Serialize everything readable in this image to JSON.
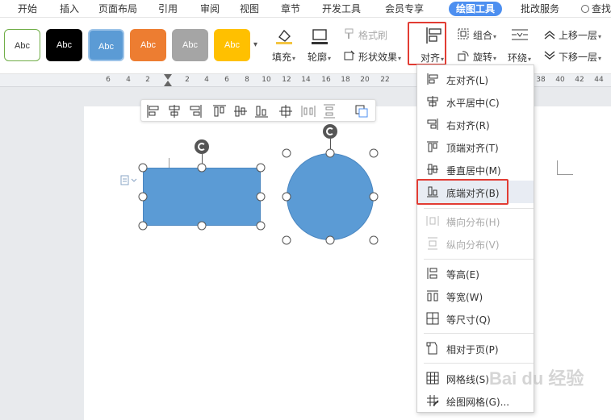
{
  "menu": {
    "tabs": [
      "开始",
      "插入",
      "页面布局",
      "引用",
      "审阅",
      "视图",
      "章节",
      "开发工具",
      "会员专享",
      "绘图工具",
      "批改服务"
    ],
    "active_tab": "绘图工具",
    "search": "查找"
  },
  "ribbon": {
    "styles": [
      "Abc",
      "Abc",
      "Abc",
      "Abc",
      "Abc",
      "Abc"
    ],
    "fill": "填充",
    "outline": "轮廓",
    "format_brush": "格式刷",
    "shape_effects": "形状效果",
    "align": "对齐",
    "group": "组合",
    "rotate": "旋转",
    "wrap": "环绕",
    "move_up": "上移一层",
    "move_down": "下移一层"
  },
  "ruler": [
    "6",
    "4",
    "2",
    "2",
    "4",
    "6",
    "8",
    "10",
    "12",
    "14",
    "16",
    "18",
    "20",
    "22",
    "38",
    "40",
    "42",
    "44"
  ],
  "align_menu": {
    "items": [
      {
        "label": "左对齐(L)",
        "icon": "align-left-icon"
      },
      {
        "label": "水平居中(C)",
        "icon": "align-center-icon"
      },
      {
        "label": "右对齐(R)",
        "icon": "align-right-icon"
      },
      {
        "label": "顶端对齐(T)",
        "icon": "align-top-icon"
      },
      {
        "label": "垂直居中(M)",
        "icon": "align-middle-icon"
      },
      {
        "label": "底端对齐(B)",
        "icon": "align-bottom-icon"
      },
      {
        "label": "横向分布(H)",
        "icon": "distribute-horizontal-icon"
      },
      {
        "label": "纵向分布(V)",
        "icon": "distribute-vertical-icon"
      },
      {
        "label": "等高(E)",
        "icon": "equal-height-icon"
      },
      {
        "label": "等宽(W)",
        "icon": "equal-width-icon"
      },
      {
        "label": "等尺寸(Q)",
        "icon": "equal-size-icon"
      },
      {
        "label": "相对于页(P)",
        "icon": "relative-to-page-icon"
      },
      {
        "label": "网格线(S)",
        "icon": "gridlines-icon"
      },
      {
        "label": "绘图网格(G)...",
        "icon": "drawing-grid-icon"
      }
    ],
    "selected": "底端对齐(B)"
  },
  "watermark": "Bai du 经验",
  "colors": {
    "accent": "#4d8ff0",
    "highlight": "#e23c33",
    "shape_fill": "#5b9bd5"
  }
}
